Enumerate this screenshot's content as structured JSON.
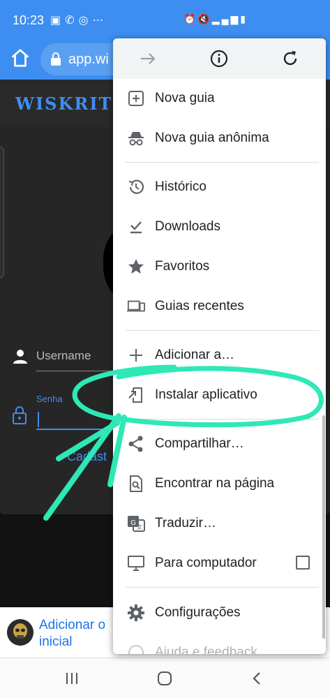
{
  "status_bar": {
    "time": "10:23",
    "left_icons": [
      "image-icon",
      "phone-icon",
      "whatsapp-icon",
      "more-dots-icon"
    ],
    "right_icons": [
      "alarm-icon",
      "mute-icon",
      "4g-signal-icon",
      "battery-icon"
    ]
  },
  "toolbar": {
    "url": "app.wi",
    "accent": "#3d8ef0"
  },
  "site": {
    "logo": "WISKRIT",
    "username_placeholder": "Username",
    "password_label": "Senha",
    "cadastro_link": "Cadast"
  },
  "banner": {
    "text": "Adicionar o inicial"
  },
  "menu": {
    "top_actions": [
      "forward-icon",
      "info-icon",
      "reload-icon"
    ],
    "items": [
      {
        "label": "Nova guia",
        "icon": "new-tab-icon"
      },
      {
        "label": "Nova guia anônima",
        "icon": "incognito-icon"
      },
      {
        "label": "Histórico",
        "icon": "history-icon"
      },
      {
        "label": "Downloads",
        "icon": "downloads-icon"
      },
      {
        "label": "Favoritos",
        "icon": "star-icon"
      },
      {
        "label": "Guias recentes",
        "icon": "devices-icon"
      },
      {
        "label": "Adicionar a…",
        "icon": "plus-icon"
      },
      {
        "label": "Instalar aplicativo",
        "icon": "install-app-icon"
      },
      {
        "label": "Compartilhar…",
        "icon": "share-icon"
      },
      {
        "label": "Encontrar na página",
        "icon": "find-in-page-icon"
      },
      {
        "label": "Traduzir…",
        "icon": "translate-icon"
      },
      {
        "label": "Para computador",
        "icon": "desktop-icon",
        "checkbox": false
      },
      {
        "label": "Configurações",
        "icon": "settings-icon"
      },
      {
        "label": "Ajuda e feedback",
        "icon": "help-icon"
      }
    ]
  },
  "annotation": {
    "color": "#2ee8b6",
    "highlighted_item": "Instalar aplicativo"
  }
}
